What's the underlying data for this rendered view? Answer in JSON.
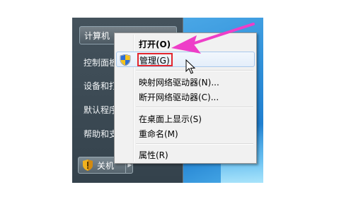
{
  "start_menu": {
    "computer": "计算机",
    "items": [
      "控制面板",
      "设备和打",
      "默认程序",
      "帮助和支"
    ],
    "shutdown_label": "关机"
  },
  "context_menu": {
    "items": [
      {
        "label": "打开(O)"
      },
      {
        "label": "管理(G)"
      },
      {
        "label": "映射网络驱动器(N)..."
      },
      {
        "label": "断开网络驱动器(C)..."
      },
      {
        "label": "在桌面上显示(S)"
      },
      {
        "label": "重命名(M)"
      },
      {
        "label": "属性(R)"
      }
    ]
  },
  "colors": {
    "annotation_arrow": "#ee3ec8",
    "highlight_box": "#e3262e",
    "desktop_blue": "#2f8fd8"
  },
  "icons": {
    "uac_shield": "uac-shield-icon",
    "shutdown_shield": "shield-icon",
    "cursor": "mouse-cursor-icon"
  }
}
